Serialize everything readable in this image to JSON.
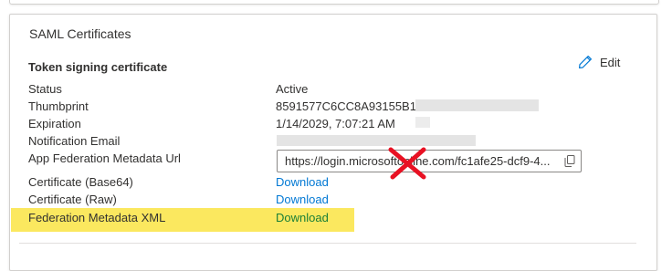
{
  "card": {
    "title": "SAML Certificates"
  },
  "section": {
    "title": "Token signing certificate",
    "edit_label": "Edit"
  },
  "fields": {
    "status": {
      "label": "Status",
      "value": "Active"
    },
    "thumbprint": {
      "label": "Thumbprint",
      "value": "8591577C6CC8A93155B16"
    },
    "expiration": {
      "label": "Expiration",
      "value": "1/14/2029, 7:07:21 AM"
    },
    "notification_email": {
      "label": "Notification Email",
      "value": ""
    },
    "metadata_url": {
      "label": "App Federation Metadata Url",
      "value": "https://login.microsoftonline.com/fc1afe25-dcf9-4..."
    },
    "cert_base64": {
      "label": "Certificate (Base64)",
      "link": "Download"
    },
    "cert_raw": {
      "label": "Certificate (Raw)",
      "link": "Download"
    },
    "federation_xml": {
      "label": "Federation Metadata XML",
      "link": "Download"
    }
  },
  "icons": {
    "edit": "pencil-icon",
    "copy": "copy-icon",
    "annotation": "red-x-mark"
  },
  "colors": {
    "link": "#0078d4",
    "highlight": "#fbe64e",
    "annotation_red": "#e81123"
  }
}
